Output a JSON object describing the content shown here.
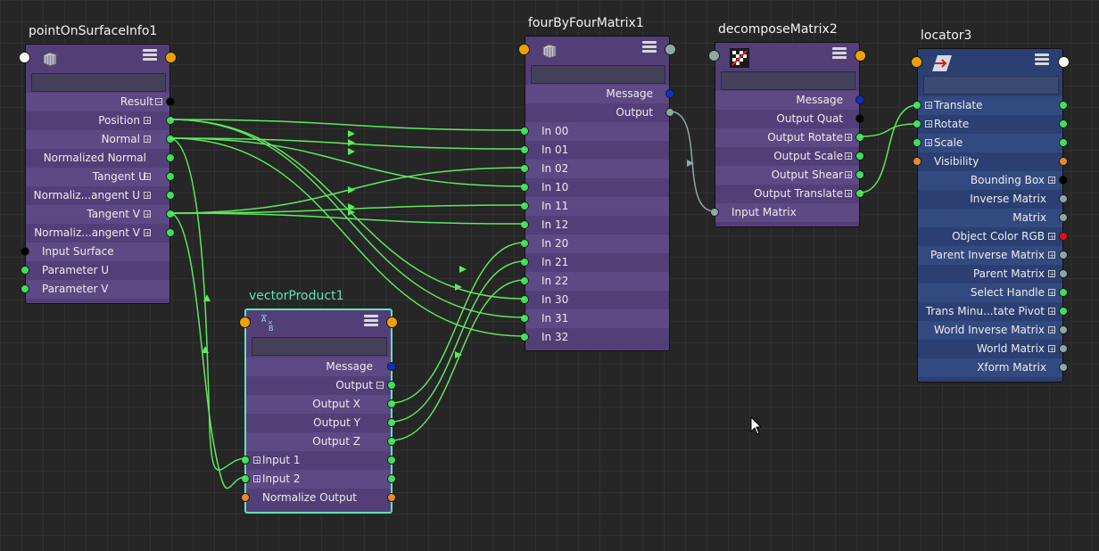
{
  "colors": {
    "background": "#262626",
    "node_purple": "#533f78",
    "node_purple_alt": "#5d4984",
    "node_blue": "#2b3f72",
    "node_blue_alt": "#334a80",
    "wire_green": "#5ee85e",
    "wire_gray": "#8aa8a8",
    "selection_outline": "#5fe2b6",
    "plug_green": "#3fe05a",
    "plug_orange": "#e88a2a",
    "plug_blue": "#1030c8",
    "plug_gray": "#8fa6a6",
    "plug_black": "#000000",
    "plug_red": "#e01010"
  },
  "nodes": {
    "pointOnSurfaceInfo": {
      "title": "pointOnSurfaceInfo1",
      "icon": "surface-point-icon",
      "attributes": [
        "Result",
        "Position",
        "Normal",
        "Normalized Normal",
        "Tangent U",
        "Normaliz...angent U",
        "Tangent V",
        "Normaliz...angent V",
        "Input Surface",
        "Parameter U",
        "Parameter V"
      ]
    },
    "vectorProduct": {
      "title": "vectorProduct1",
      "icon": "vector-product-icon",
      "attributes": [
        "Message",
        "Output",
        "Output X",
        "Output Y",
        "Output Z",
        "Input 1",
        "Input 2",
        "Normalize Output"
      ]
    },
    "fourByFourMatrix": {
      "title": "fourByFourMatrix1",
      "icon": "matrix-icon",
      "attributes": [
        "Message",
        "Output",
        "In 00",
        "In 01",
        "In 02",
        "In 10",
        "In 11",
        "In 12",
        "In 20",
        "In 21",
        "In 22",
        "In 30",
        "In 31",
        "In 32"
      ]
    },
    "decomposeMatrix": {
      "title": "decomposeMatrix2",
      "icon": "decompose-matrix-icon",
      "attributes": [
        "Message",
        "Output Quat",
        "Output Rotate",
        "Output Scale",
        "Output Shear",
        "Output Translate",
        "Input Matrix"
      ]
    },
    "locator": {
      "title": "locator3",
      "icon": "locator-icon",
      "attributes": [
        "Translate",
        "Rotate",
        "Scale",
        "Visibility",
        "Bounding Box",
        "Inverse Matrix",
        "Matrix",
        "Object Color RGB",
        "Parent Inverse Matrix",
        "Parent Matrix",
        "Select Handle",
        "Trans Minu...tate Pivot",
        "World Inverse Matrix",
        "World Matrix",
        "Xform Matrix"
      ]
    }
  }
}
